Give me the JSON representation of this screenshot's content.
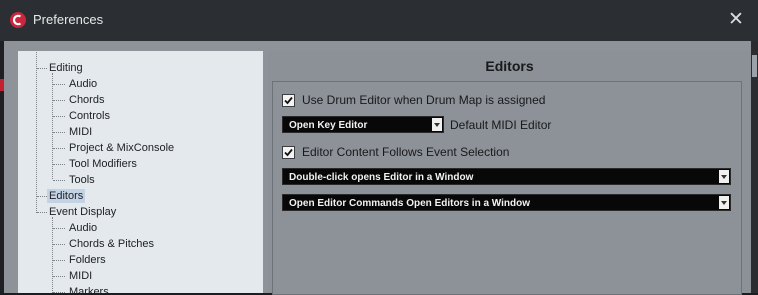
{
  "window": {
    "title": "Preferences",
    "close_glyph": "✕"
  },
  "tree": {
    "items": [
      {
        "label": "Editing",
        "level": 0
      },
      {
        "label": "Audio",
        "level": 1
      },
      {
        "label": "Chords",
        "level": 1
      },
      {
        "label": "Controls",
        "level": 1
      },
      {
        "label": "MIDI",
        "level": 1
      },
      {
        "label": "Project & MixConsole",
        "level": 1
      },
      {
        "label": "Tool Modifiers",
        "level": 1
      },
      {
        "label": "Tools",
        "level": 1
      },
      {
        "label": "Editors",
        "level": 0,
        "selected": true
      },
      {
        "label": "Event Display",
        "level": 0
      },
      {
        "label": "Audio",
        "level": 1
      },
      {
        "label": "Chords & Pitches",
        "level": 1
      },
      {
        "label": "Folders",
        "level": 1
      },
      {
        "label": "MIDI",
        "level": 1
      },
      {
        "label": "Markers",
        "level": 1
      }
    ]
  },
  "panel": {
    "title": "Editors",
    "use_drum_editor": {
      "label": "Use Drum Editor when Drum Map is assigned",
      "checked": true
    },
    "default_midi_editor": {
      "value": "Open Key Editor",
      "label": "Default MIDI Editor"
    },
    "editor_content_follows": {
      "label": "Editor Content Follows Event Selection",
      "checked": true
    },
    "double_click_select": {
      "value": "Double-click opens Editor in a Window"
    },
    "editor_commands_select": {
      "value": "Open Editor Commands Open Editors in a Window"
    }
  },
  "colors": {
    "accent_logo": "#c8283d",
    "selection": "#c3d3e5",
    "dialog_bg": "#8e9399",
    "tree_bg": "#e4e9ee"
  }
}
